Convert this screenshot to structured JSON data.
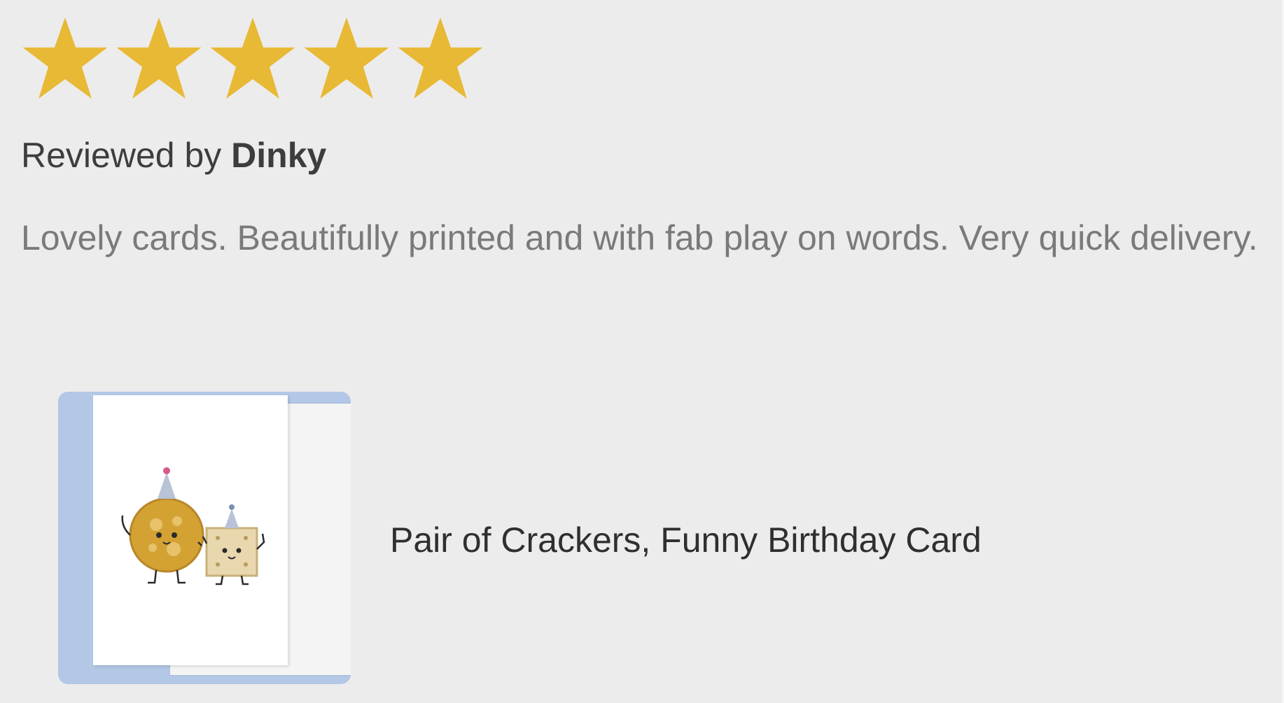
{
  "rating": {
    "value": 5,
    "max": 5,
    "color": "#e7b935",
    "icon": "star-icon"
  },
  "review": {
    "reviewed_by_prefix": "Reviewed by",
    "reviewer_name": "Dinky",
    "text": "Lovely cards. Beautifully printed and with fab play on words. Very quick delivery."
  },
  "product": {
    "title": "Pair of Crackers, Funny Birthday Card",
    "image_background_color": "#b3c7e6"
  }
}
